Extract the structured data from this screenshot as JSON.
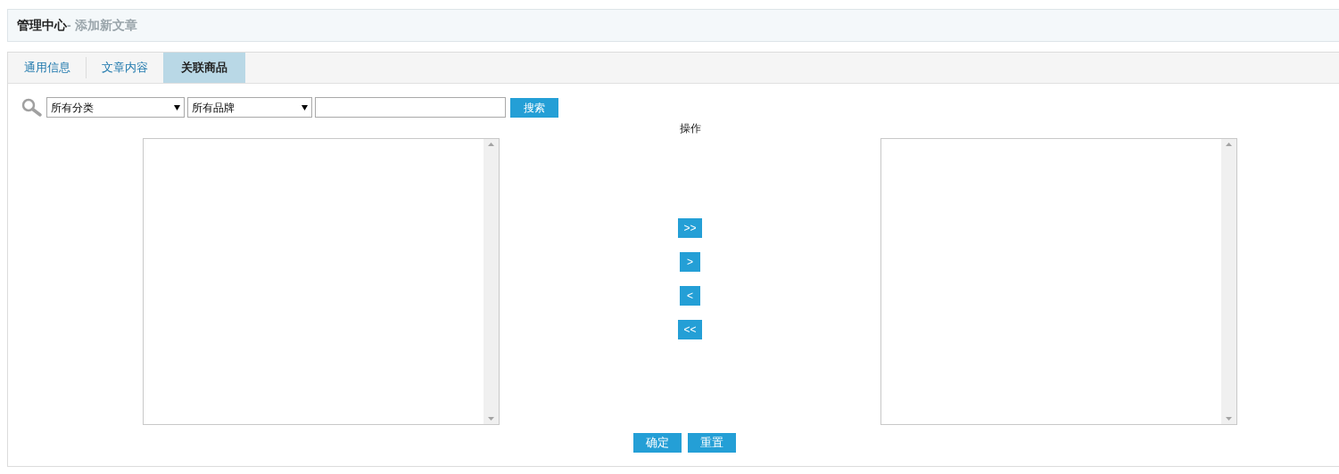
{
  "header": {
    "title": "管理中心",
    "subtitle": "- 添加新文章"
  },
  "tabs": [
    {
      "label": "通用信息",
      "selected": false
    },
    {
      "label": "文章内容",
      "selected": false
    },
    {
      "label": "关联商品",
      "selected": true
    }
  ],
  "search": {
    "category": "所有分类",
    "brand": "所有品牌",
    "button": "搜索"
  },
  "operation_label": "操作",
  "move_buttons": [
    ">>",
    ">",
    "<",
    "<<"
  ],
  "footer_buttons": [
    "确定",
    "重置"
  ]
}
